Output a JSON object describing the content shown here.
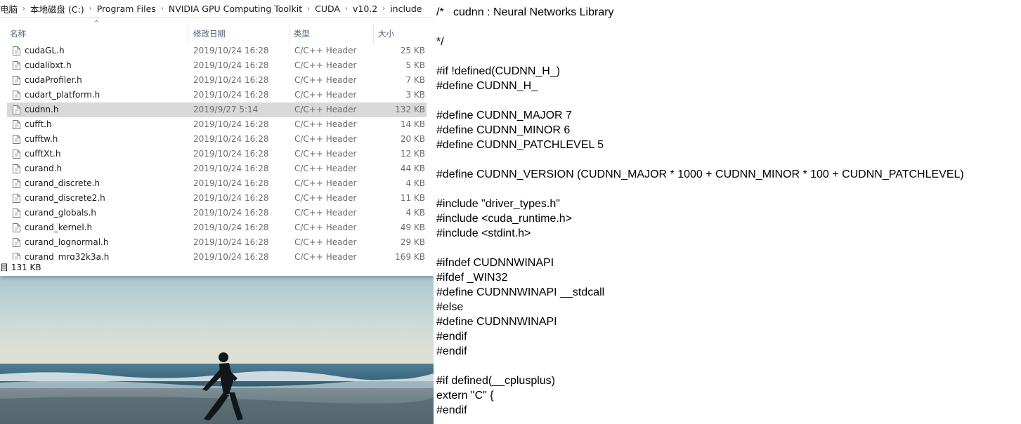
{
  "explorer": {
    "breadcrumb": [
      "电脑",
      "本地磁盘 (C:)",
      "Program Files",
      "NVIDIA GPU Computing Toolkit",
      "CUDA",
      "v10.2",
      "include"
    ],
    "columns": {
      "name": "名称",
      "date": "修改日期",
      "type": "类型",
      "size": "大小"
    },
    "files": [
      {
        "name": "cudaGL.h",
        "date": "2019/10/24 16:28",
        "type": "C/C++ Header",
        "size": "25 KB"
      },
      {
        "name": "cudalibxt.h",
        "date": "2019/10/24 16:28",
        "type": "C/C++ Header",
        "size": "5 KB"
      },
      {
        "name": "cudaProfiler.h",
        "date": "2019/10/24 16:28",
        "type": "C/C++ Header",
        "size": "7 KB"
      },
      {
        "name": "cudart_platform.h",
        "date": "2019/10/24 16:28",
        "type": "C/C++ Header",
        "size": "3 KB"
      },
      {
        "name": "cudnn.h",
        "date": "2019/9/27 5:14",
        "type": "C/C++ Header",
        "size": "132 KB",
        "selected": true
      },
      {
        "name": "cufft.h",
        "date": "2019/10/24 16:28",
        "type": "C/C++ Header",
        "size": "14 KB"
      },
      {
        "name": "cufftw.h",
        "date": "2019/10/24 16:28",
        "type": "C/C++ Header",
        "size": "20 KB"
      },
      {
        "name": "cufftXt.h",
        "date": "2019/10/24 16:28",
        "type": "C/C++ Header",
        "size": "12 KB"
      },
      {
        "name": "curand.h",
        "date": "2019/10/24 16:28",
        "type": "C/C++ Header",
        "size": "44 KB"
      },
      {
        "name": "curand_discrete.h",
        "date": "2019/10/24 16:28",
        "type": "C/C++ Header",
        "size": "4 KB"
      },
      {
        "name": "curand_discrete2.h",
        "date": "2019/10/24 16:28",
        "type": "C/C++ Header",
        "size": "11 KB"
      },
      {
        "name": "curand_globals.h",
        "date": "2019/10/24 16:28",
        "type": "C/C++ Header",
        "size": "4 KB"
      },
      {
        "name": "curand_kernel.h",
        "date": "2019/10/24 16:28",
        "type": "C/C++ Header",
        "size": "49 KB"
      },
      {
        "name": "curand_lognormal.h",
        "date": "2019/10/24 16:28",
        "type": "C/C++ Header",
        "size": "29 KB"
      },
      {
        "name": "curand_mrg32k3a.h",
        "date": "2019/10/24 16:28",
        "type": "C/C++ Header",
        "size": "169 KB"
      }
    ],
    "status": "目 131 KB"
  },
  "code": {
    "lines": [
      "/*   cudnn : Neural Networks Library",
      "",
      "*/",
      "",
      "#if !defined(CUDNN_H_)",
      "#define CUDNN_H_",
      "",
      "#define CUDNN_MAJOR 7",
      "#define CUDNN_MINOR 6",
      "#define CUDNN_PATCHLEVEL 5",
      "",
      "#define CUDNN_VERSION (CUDNN_MAJOR * 1000 + CUDNN_MINOR * 100 + CUDNN_PATCHLEVEL)",
      "",
      "#include \"driver_types.h\"",
      "#include <cuda_runtime.h>",
      "#include <stdint.h>",
      "",
      "#ifndef CUDNNWINAPI",
      "#ifdef _WIN32",
      "#define CUDNNWINAPI __stdcall",
      "#else",
      "#define CUDNNWINAPI",
      "#endif",
      "#endif",
      "",
      "#if defined(__cplusplus)",
      "extern \"C\" {",
      "#endif"
    ]
  },
  "icons": {
    "file": "header-file-icon",
    "chevron": "chevron-right-icon",
    "sort": "sort-up-icon"
  },
  "colors": {
    "selection": "#d9d9d9",
    "header_text": "#4c607a",
    "muted_text": "#6d6d6d"
  }
}
